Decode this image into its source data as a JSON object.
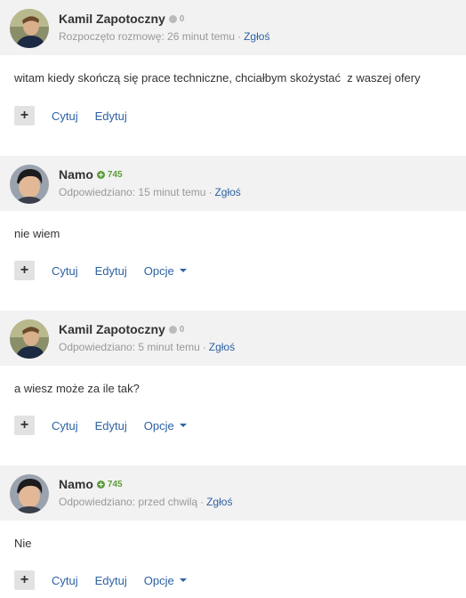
{
  "colors": {
    "link": "#2d62a3",
    "positive_rep": "#5c9c3a",
    "header_bg": "#f2f2f2"
  },
  "actions": {
    "quote": "Cytuj",
    "edit": "Edytuj",
    "options": "Opcje",
    "report": "Zgłoś"
  },
  "posts": [
    {
      "author": "Kamil Zapotoczny",
      "reputation": "0",
      "reputation_type": "neutral",
      "meta": "Rozpoczęto rozmowę: 26 minut temu",
      "report": "Zgłoś",
      "body": "witam kiedy skończą się prace techniczne, chciałbym skożystać  z waszej ofery",
      "quote": "Cytuj",
      "edit": "Edytuj"
    },
    {
      "author": "Namo",
      "reputation": "745",
      "reputation_type": "positive",
      "meta": "Odpowiedziano: 15 minut temu",
      "report": "Zgłoś",
      "body": "nie wiem",
      "quote": "Cytuj",
      "edit": "Edytuj",
      "options": "Opcje"
    },
    {
      "author": "Kamil Zapotoczny",
      "reputation": "0",
      "reputation_type": "neutral",
      "meta": "Odpowiedziano: 5 minut temu",
      "report": "Zgłoś",
      "body": "a wiesz może za ile tak?",
      "quote": "Cytuj",
      "edit": "Edytuj",
      "options": "Opcje"
    },
    {
      "author": "Namo",
      "reputation": "745",
      "reputation_type": "positive",
      "meta": "Odpowiedziano: przed chwilą",
      "report": "Zgłoś",
      "body": "Nie",
      "quote": "Cytuj",
      "edit": "Edytuj",
      "options": "Opcje"
    }
  ]
}
